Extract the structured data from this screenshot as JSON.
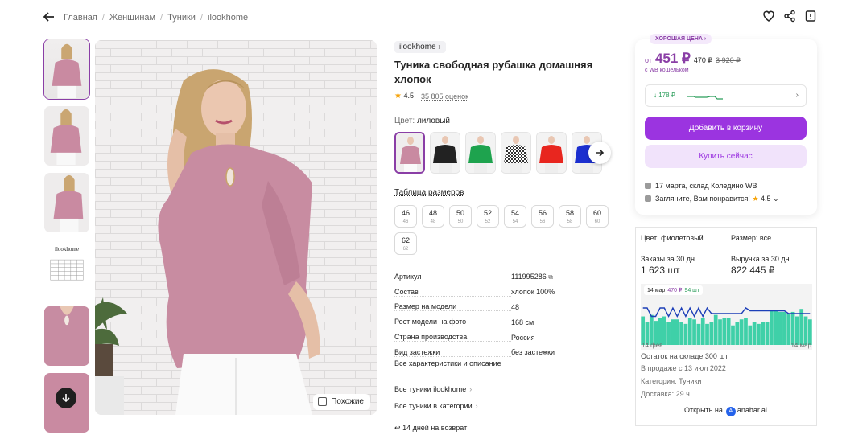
{
  "header": {
    "breadcrumbs": [
      "Главная",
      "Женщинам",
      "Туники",
      "ilookhome"
    ]
  },
  "gallery": {
    "similar_label": "Похожие",
    "thumbnail_brand": "ilookhome"
  },
  "product": {
    "brand": "ilookhome",
    "title": "Туника свободная рубашка домашняя хлопок",
    "rating": "4.5",
    "reviews": "35 805 оценок",
    "color_label": "Цвет:",
    "color_value": "лиловый",
    "size_table": "Таблица размеров",
    "sizes": [
      {
        "ru": "46",
        "alt": "46"
      },
      {
        "ru": "48",
        "alt": "48"
      },
      {
        "ru": "50",
        "alt": "50"
      },
      {
        "ru": "52",
        "alt": "52"
      },
      {
        "ru": "54",
        "alt": "54"
      },
      {
        "ru": "56",
        "alt": "56"
      },
      {
        "ru": "58",
        "alt": "58"
      },
      {
        "ru": "60",
        "alt": "60"
      },
      {
        "ru": "62",
        "alt": "62"
      }
    ],
    "specs": [
      {
        "k": "Артикул",
        "v": "111995286"
      },
      {
        "k": "Состав",
        "v": "хлопок 100%"
      },
      {
        "k": "Размер на модели",
        "v": "48"
      },
      {
        "k": "Рост модели на фото",
        "v": "168 см"
      },
      {
        "k": "Страна производства",
        "v": "Россия"
      },
      {
        "k": "Вид застежки",
        "v": "без застежки"
      }
    ],
    "all_specs_link": "Все характеристики и описание",
    "links": [
      "Все туники ilookhome",
      "Все туники в категории"
    ],
    "return_text": "14 дней на возврат"
  },
  "price_card": {
    "good_price": "ХОРОШАЯ ЦЕНА",
    "prefix": "от",
    "price": "451 ₽",
    "price_no_wallet": "470 ₽",
    "old_price": "3 920 ₽",
    "wallet_note": "с WB кошельком",
    "history_delta": "↓ 178 ₽",
    "add_to_cart": "Добавить в корзину",
    "buy_now": "Купить сейчас",
    "delivery": "17 марта, склад Коледино WB",
    "recommend": "Загляните, Вам понравится!",
    "recommend_rating": "4.5"
  },
  "stats": {
    "color": "Цвет: фиолетовый",
    "size": "Размер: все",
    "orders_label": "Заказы за 30 дн",
    "orders_value": "1 623 шт",
    "revenue_label": "Выручка за 30 дн",
    "revenue_value": "822 445 ₽",
    "tooltip_date": "14 мар",
    "tooltip_price": "470 ₽",
    "tooltip_qty": "94 шт",
    "date_start": "14 фев",
    "date_end": "14 мар",
    "stock": "Остаток на складе 300 шт",
    "since": "В продаже с 13 июл 2022",
    "category": "Категория: Туники",
    "delivery": "Доставка: 29 ч.",
    "open_on": "Открыть на",
    "service": "anabar.ai"
  },
  "chart_data": {
    "type": "bar",
    "values": [
      38,
      30,
      40,
      32,
      36,
      38,
      30,
      34,
      34,
      30,
      28,
      36,
      34,
      28,
      36,
      28,
      30,
      40,
      34,
      36,
      36,
      26,
      30,
      34,
      36,
      26,
      30,
      28,
      30,
      30,
      46,
      46,
      44,
      44,
      42,
      44,
      38,
      48,
      38,
      34
    ],
    "price_line": [
      470,
      470,
      440,
      440,
      470,
      470,
      440,
      470,
      440,
      470,
      440,
      470,
      440,
      470,
      440,
      470,
      450,
      450,
      450,
      450,
      450,
      450,
      450,
      450,
      470,
      460,
      460,
      460,
      460,
      460,
      460,
      460,
      460,
      460,
      450,
      450,
      450,
      450,
      450,
      450
    ]
  },
  "colors": {
    "accent": "#9b34e0",
    "brand_purple": "#8a3ea6",
    "bar": "#3fd0a8",
    "line": "#1d3fb8"
  }
}
